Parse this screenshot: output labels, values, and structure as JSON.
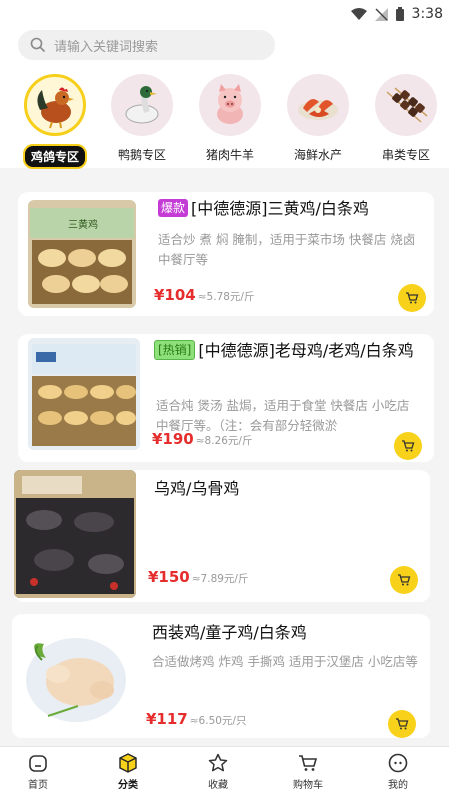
{
  "status_bar": {
    "time": "3:38"
  },
  "search": {
    "placeholder": "请输入关键词搜索"
  },
  "categories": [
    {
      "label": "鸡鸽专区",
      "icon": "rooster-icon"
    },
    {
      "label": "鸭鹅专区",
      "icon": "duck-icon"
    },
    {
      "label": "猪肉牛羊",
      "icon": "pig-icon"
    },
    {
      "label": "海鲜水产",
      "icon": "shrimp-icon"
    },
    {
      "label": "串类专区",
      "icon": "skewer-icon"
    }
  ],
  "products": [
    {
      "tag": "爆款",
      "title": "[中德德源]三黄鸡/白条鸡",
      "desc": "适合炒 煮 焖 腌制，适用于菜市场 快餐店 烧卤 中餐厅等",
      "price": "¥104",
      "unit_price": "≈5.78元/斤"
    },
    {
      "tag": "[热销]",
      "title": "[中德德源]老母鸡/老鸡/白条鸡",
      "desc": "适合炖 煲汤 盐焗，适用于食堂 快餐店 小吃店 中餐厅等。（注：会有部分轻微淤",
      "price": "¥190",
      "unit_price": "≈8.26元/斤"
    },
    {
      "tag": "",
      "title": "乌鸡/乌骨鸡",
      "desc": "",
      "price": "¥150",
      "unit_price": "≈7.89元/斤"
    },
    {
      "tag": "",
      "title": "西装鸡/童子鸡/白条鸡",
      "desc": "合适做烤鸡 炸鸡 手撕鸡 适用于汉堡店 小吃店等",
      "price": "¥117",
      "unit_price": "≈6.50元/只"
    }
  ],
  "nav": [
    {
      "label": "首页",
      "icon": "home-icon"
    },
    {
      "label": "分类",
      "icon": "category-box-icon"
    },
    {
      "label": "收藏",
      "icon": "star-icon"
    },
    {
      "label": "购物车",
      "icon": "cart-icon"
    },
    {
      "label": "我的",
      "icon": "profile-icon"
    }
  ]
}
